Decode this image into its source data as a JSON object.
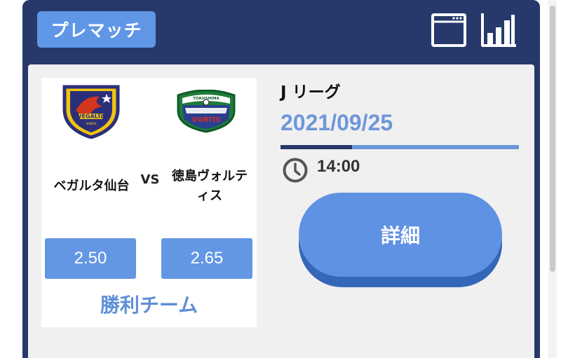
{
  "header": {
    "badge_label": "プレマッチ",
    "icons": [
      "window-icon",
      "bar-chart-icon"
    ]
  },
  "match": {
    "home": {
      "name": "ベガルタ仙台",
      "crest_text": "VEGALTA",
      "crest_subtext": "SENDAI",
      "odds": "2.50"
    },
    "vs_label": "VS",
    "away": {
      "name_line1": "徳島ヴォルテ",
      "name_line2": "ィス",
      "crest_text_top": "TOKUSHIMA",
      "crest_text_main": "VORTIS",
      "odds": "2.65"
    },
    "winner_label": "勝利チーム"
  },
  "info": {
    "league": "J リーグ",
    "date": "2021/09/25",
    "date_progress": 0.3,
    "time": "14:00",
    "detail_label": "詳細"
  },
  "colors": {
    "navy": "#27386b",
    "accent": "#5f92e2"
  }
}
